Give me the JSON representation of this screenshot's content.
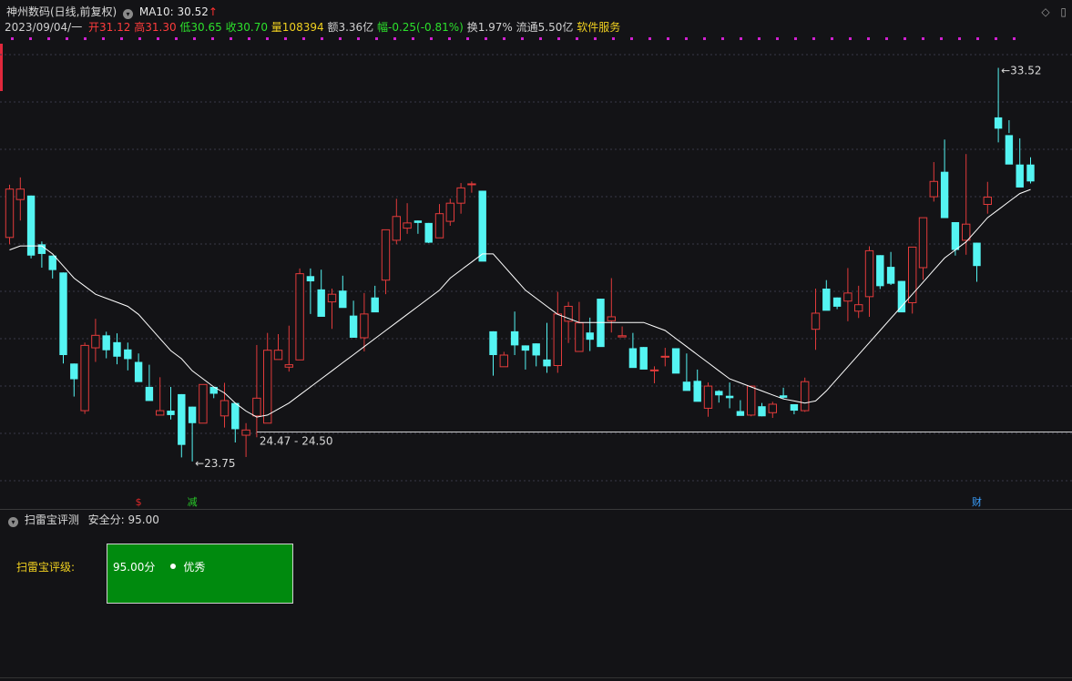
{
  "header": {
    "stock_name": "神州数码(日线,前复权)",
    "ma_label": "MA10: 30.52",
    "ma_arrow": "↑",
    "date": "2023/09/04/一",
    "open": "开31.12",
    "high": "高31.30",
    "low": "低30.65",
    "close": "收30.70",
    "volume": "量108394",
    "amount": "额3.36亿",
    "change": "幅-0.25(-0.81%)",
    "turnover": "换1.97%",
    "float": "流通5.50亿",
    "service": "软件服务"
  },
  "window_icons": [
    "diamond-icon",
    "panel-icon"
  ],
  "annotations": {
    "high_label": "33.52",
    "low_label": "23.75",
    "range_label": "24.47 - 24.50",
    "markers": [
      {
        "text": "$",
        "color": "#e02828",
        "index": 12
      },
      {
        "text": "减",
        "color": "#28c828",
        "index": 17
      },
      {
        "text": "财",
        "color": "#3aa0ff",
        "index": 90
      }
    ]
  },
  "indicator": {
    "title": "扫雷宝评测",
    "score_text": "安全分: 95.00",
    "rating_label": "扫雷宝评级:",
    "rating_score": "95.00分",
    "rating_text": "优秀"
  },
  "chart_data": {
    "type": "candlestick",
    "title": "神州数码(日线,前复权)",
    "ylim": [
      23.0,
      34.3
    ],
    "colors": {
      "up": "#e23b3b",
      "down": "#54f4f2",
      "ma": "#ffffff",
      "grid": "#3a3a48"
    },
    "series": [
      {
        "name": "K线",
        "ohlc": [
          [
            29.31,
            30.62,
            29.14,
            30.51
          ],
          [
            30.25,
            30.8,
            29.73,
            30.51
          ],
          [
            30.35,
            30.35,
            28.79,
            28.86
          ],
          [
            29.14,
            29.21,
            28.56,
            28.9
          ],
          [
            28.86,
            28.86,
            28.29,
            28.5
          ],
          [
            28.44,
            28.44,
            26.18,
            26.39
          ],
          [
            26.18,
            26.18,
            25.36,
            25.79
          ],
          [
            25.01,
            26.7,
            24.93,
            26.63
          ],
          [
            26.57,
            27.29,
            26.22,
            26.88
          ],
          [
            26.88,
            26.97,
            26.31,
            26.51
          ],
          [
            26.71,
            26.93,
            26.16,
            26.35
          ],
          [
            26.53,
            26.7,
            26.01,
            26.29
          ],
          [
            26.22,
            26.43,
            25.9,
            25.72
          ],
          [
            25.6,
            26.15,
            25.45,
            25.25
          ],
          [
            24.9,
            25.84,
            24.9,
            25.01
          ],
          [
            25.01,
            25.6,
            24.79,
            24.9
          ],
          [
            25.42,
            25.42,
            23.85,
            24.16
          ],
          [
            25.11,
            25.11,
            23.75,
            24.7
          ],
          [
            24.7,
            25.66,
            24.7,
            25.66
          ],
          [
            25.6,
            25.6,
            25.32,
            25.43
          ],
          [
            24.88,
            25.7,
            24.59,
            25.26
          ],
          [
            25.2,
            25.2,
            24.22,
            24.55
          ],
          [
            24.4,
            24.7,
            23.86,
            24.53
          ],
          [
            24.88,
            26.64,
            24.35,
            25.32
          ],
          [
            24.7,
            26.94,
            24.7,
            26.51
          ],
          [
            26.28,
            26.91,
            26.28,
            26.51
          ],
          [
            26.09,
            27.12,
            25.98,
            26.15
          ],
          [
            26.27,
            28.54,
            26.27,
            28.41
          ],
          [
            28.35,
            28.54,
            27.41,
            28.22
          ],
          [
            28.02,
            28.51,
            27.49,
            27.34
          ],
          [
            27.71,
            28.04,
            27.04,
            27.9
          ],
          [
            27.99,
            28.36,
            27.76,
            27.56
          ],
          [
            27.37,
            27.74,
            26.82,
            26.82
          ],
          [
            26.82,
            27.93,
            26.48,
            27.41
          ],
          [
            27.82,
            28.11,
            27.8,
            27.45
          ],
          [
            28.25,
            29.5,
            27.9,
            29.5
          ],
          [
            29.24,
            30.27,
            29.14,
            29.83
          ],
          [
            29.54,
            30.16,
            29.4,
            29.67
          ],
          [
            29.73,
            29.73,
            29.4,
            29.67
          ],
          [
            29.67,
            29.67,
            29.17,
            29.18
          ],
          [
            29.3,
            30.14,
            29.3,
            29.9
          ],
          [
            29.71,
            30.27,
            29.6,
            30.16
          ],
          [
            30.16,
            30.66,
            29.9,
            30.54
          ],
          [
            30.64,
            30.7,
            30.42,
            30.64
          ],
          [
            30.47,
            30.47,
            28.84,
            28.71
          ],
          [
            26.98,
            26.98,
            25.88,
            26.39
          ],
          [
            26.1,
            26.47,
            26.1,
            26.39
          ],
          [
            26.98,
            27.47,
            26.39,
            26.63
          ],
          [
            26.63,
            26.63,
            26.03,
            26.5
          ],
          [
            26.68,
            26.68,
            26.11,
            26.38
          ],
          [
            26.28,
            27.19,
            25.95,
            26.11
          ],
          [
            26.13,
            27.96,
            25.95,
            27.41
          ],
          [
            27.23,
            27.71,
            26.69,
            27.6
          ],
          [
            26.48,
            27.71,
            26.48,
            27.19
          ],
          [
            26.95,
            27.32,
            26.49,
            26.77
          ],
          [
            27.79,
            27.79,
            26.6,
            26.59
          ],
          [
            27.24,
            28.3,
            26.95,
            27.34
          ],
          [
            26.84,
            27.1,
            26.84,
            26.87
          ],
          [
            26.56,
            26.94,
            26.14,
            26.07
          ],
          [
            26.59,
            26.59,
            26.05,
            26.03
          ],
          [
            26.02,
            26.11,
            25.69,
            26.02
          ],
          [
            26.36,
            26.57,
            26.11,
            26.36
          ],
          [
            26.56,
            26.56,
            25.99,
            25.93
          ],
          [
            25.73,
            26.43,
            25.73,
            25.5
          ],
          [
            25.75,
            26.03,
            25.29,
            25.23
          ],
          [
            25.07,
            25.71,
            24.86,
            25.62
          ],
          [
            25.5,
            25.52,
            25.21,
            25.39
          ],
          [
            25.38,
            25.71,
            25.07,
            25.32
          ],
          [
            25.0,
            25.27,
            24.98,
            24.88
          ],
          [
            24.9,
            25.62,
            24.87,
            25.62
          ],
          [
            25.12,
            25.2,
            24.87,
            24.87
          ],
          [
            24.96,
            25.23,
            24.83,
            25.17
          ],
          [
            25.39,
            25.58,
            25.31,
            25.33
          ],
          [
            25.17,
            25.17,
            24.92,
            25.01
          ],
          [
            25.01,
            25.83,
            24.98,
            25.73
          ],
          [
            27.03,
            28.04,
            26.52,
            27.43
          ],
          [
            28.04,
            28.25,
            27.75,
            27.49
          ],
          [
            27.82,
            27.82,
            27.53,
            27.59
          ],
          [
            27.73,
            28.55,
            27.23,
            27.93
          ],
          [
            27.48,
            28.11,
            27.31,
            27.64
          ],
          [
            27.84,
            29.09,
            27.34,
            28.98
          ],
          [
            28.87,
            28.87,
            28.03,
            28.1
          ],
          [
            28.58,
            28.95,
            28.13,
            28.16
          ],
          [
            28.23,
            28.23,
            27.89,
            27.45
          ],
          [
            27.69,
            28.55,
            27.42,
            29.07
          ],
          [
            28.56,
            29.8,
            28.26,
            29.8
          ],
          [
            30.32,
            31.18,
            30.2,
            30.7
          ],
          [
            30.94,
            31.74,
            30.85,
            29.79
          ],
          [
            29.69,
            29.69,
            28.86,
            29.0
          ],
          [
            29.24,
            31.38,
            28.88,
            29.64
          ],
          [
            29.18,
            29.18,
            28.21,
            28.6
          ],
          [
            30.13,
            30.69,
            29.9,
            30.31
          ],
          [
            32.29,
            33.52,
            31.67,
            32.01
          ],
          [
            31.85,
            32.22,
            31.9,
            31.12
          ],
          [
            31.12,
            31.77,
            30.97,
            30.55
          ],
          [
            31.12,
            31.3,
            30.65,
            30.7
          ]
        ]
      },
      {
        "name": "MA10",
        "values": [
          29.0,
          29.1,
          29.1,
          29.1,
          28.9,
          28.6,
          28.3,
          28.1,
          27.9,
          27.8,
          27.7,
          27.6,
          27.4,
          27.1,
          26.8,
          26.5,
          26.3,
          26.0,
          25.8,
          25.6,
          25.45,
          25.2,
          25.0,
          24.85,
          24.9,
          25.05,
          25.2,
          25.4,
          25.6,
          25.8,
          26.0,
          26.2,
          26.4,
          26.6,
          26.8,
          27.0,
          27.2,
          27.4,
          27.6,
          27.8,
          28.0,
          28.3,
          28.5,
          28.7,
          28.9,
          28.9,
          28.6,
          28.3,
          28.0,
          27.8,
          27.6,
          27.4,
          27.3,
          27.2,
          27.2,
          27.2,
          27.2,
          27.2,
          27.2,
          27.2,
          27.1,
          27.0,
          26.8,
          26.6,
          26.4,
          26.2,
          26.0,
          25.8,
          25.7,
          25.6,
          25.5,
          25.4,
          25.3,
          25.25,
          25.2,
          25.25,
          25.5,
          25.8,
          26.1,
          26.4,
          26.7,
          27.0,
          27.3,
          27.6,
          27.9,
          28.2,
          28.5,
          28.8,
          29.0,
          29.2,
          29.5,
          29.8,
          30.0,
          30.2,
          30.4,
          30.5
        ]
      }
    ]
  }
}
